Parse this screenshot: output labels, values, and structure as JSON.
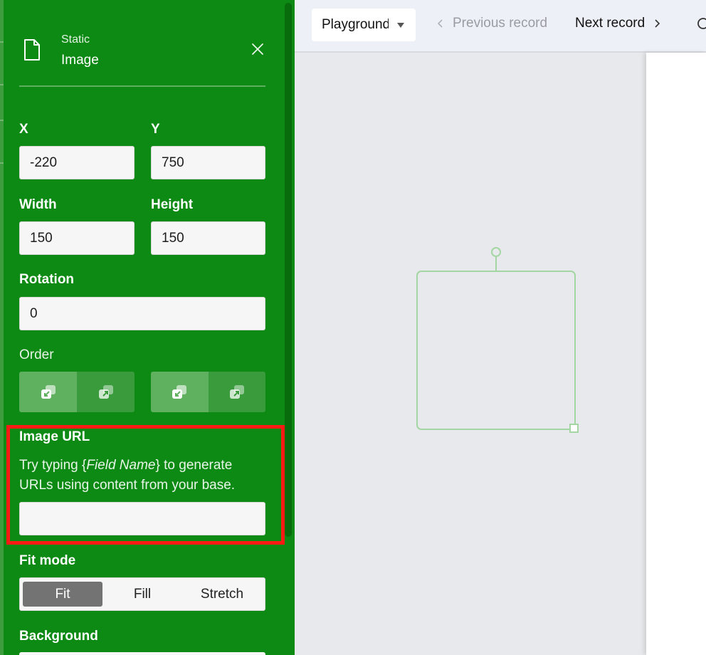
{
  "panel": {
    "header": {
      "subtitle": "Static",
      "title": "Image",
      "icon": "file-icon",
      "close_icon": "close-icon"
    },
    "fields": {
      "x": {
        "label": "X",
        "value": "-220"
      },
      "y": {
        "label": "Y",
        "value": "750"
      },
      "width": {
        "label": "Width",
        "value": "150"
      },
      "height": {
        "label": "Height",
        "value": "150"
      },
      "rotation": {
        "label": "Rotation",
        "value": "0"
      }
    },
    "order": {
      "label": "Order"
    },
    "image_url": {
      "label": "Image URL",
      "help_prefix": "Try typing {",
      "help_emphasis": "Field Name",
      "help_suffix": "} to generate URLs using content from your base.",
      "value": ""
    },
    "fit_mode": {
      "label": "Fit mode",
      "options": [
        "Fit",
        "Fill",
        "Stretch"
      ],
      "selected": "Fit"
    },
    "background": {
      "label": "Background"
    }
  },
  "topbar": {
    "select_value": "Playground",
    "prev_label": "Previous record",
    "next_label": "Next record"
  },
  "colors": {
    "panel_bg": "#0d8a14",
    "highlight": "#fe1a14",
    "selected_option": "#737373"
  }
}
